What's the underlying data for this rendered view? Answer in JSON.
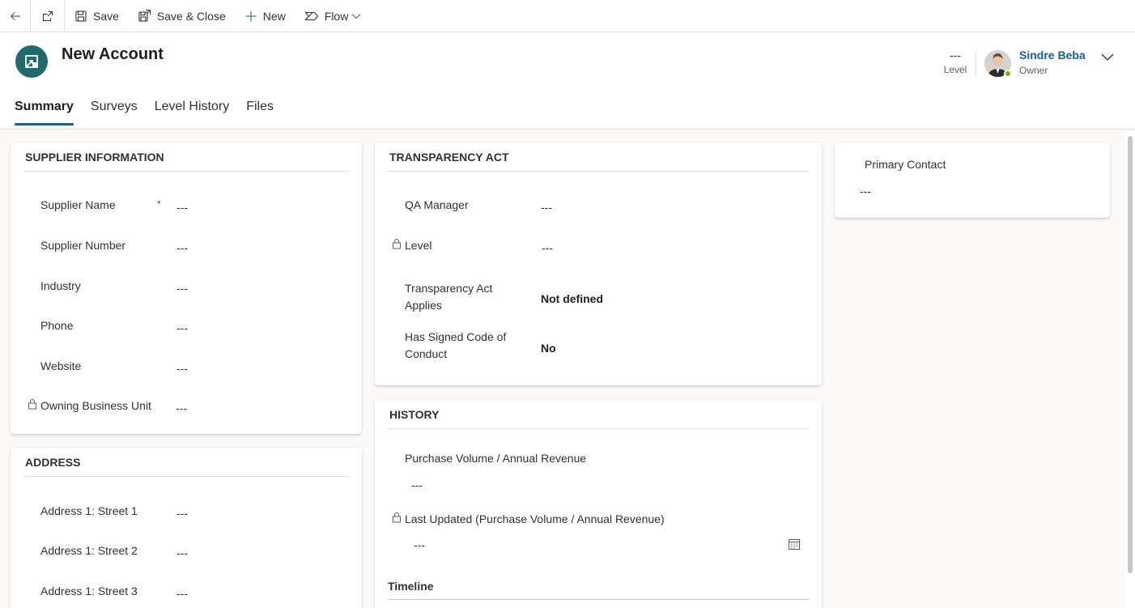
{
  "toolbar": {
    "save_label": "Save",
    "save_close_label": "Save & Close",
    "new_label": "New",
    "flow_label": "Flow"
  },
  "header": {
    "title": "New Account",
    "level_value": "---",
    "level_label": "Level",
    "owner_name": "Sindre Beba",
    "owner_label": "Owner"
  },
  "tabs": [
    {
      "label": "Summary",
      "active": true
    },
    {
      "label": "Surveys",
      "active": false
    },
    {
      "label": "Level History",
      "active": false
    },
    {
      "label": "Files",
      "active": false
    }
  ],
  "supplier_info": {
    "title": "SUPPLIER INFORMATION",
    "fields": [
      {
        "label": "Supplier Name",
        "value": "---"
      },
      {
        "label": "Supplier Number",
        "value": "---"
      },
      {
        "label": "Industry",
        "value": "---"
      },
      {
        "label": "Phone",
        "value": "---"
      },
      {
        "label": "Website",
        "value": "---"
      },
      {
        "label": "Owning Business Unit",
        "value": "---"
      }
    ],
    "required_marker": "*"
  },
  "address": {
    "title": "ADDRESS",
    "fields": [
      {
        "label": "Address 1: Street 1",
        "value": "---"
      },
      {
        "label": "Address 1: Street 2",
        "value": "---"
      },
      {
        "label": "Address 1: Street 3",
        "value": "---"
      }
    ]
  },
  "transparency": {
    "title": "TRANSPARENCY ACT",
    "fields": [
      {
        "label": "QA Manager",
        "value": "---"
      },
      {
        "label": "Level",
        "value": "---"
      },
      {
        "label_line1": "Transparency Act",
        "label_line2": "Applies",
        "value": "Not defined"
      },
      {
        "label_line1": "Has Signed Code of",
        "label_line2": "Conduct",
        "value": "No"
      }
    ]
  },
  "history": {
    "title": "HISTORY",
    "purchase_label": "Purchase Volume / Annual Revenue",
    "purchase_value": "---",
    "last_updated_label": "Last Updated (Purchase Volume / Annual Revenue)",
    "last_updated_value": "---",
    "timeline_label": "Timeline"
  },
  "primary_contact": {
    "label": "Primary Contact",
    "value": "---"
  },
  "colors": {
    "accent": "#115ea3",
    "entity_icon": "#1f6b6b",
    "presence": "#6bb700",
    "required": "#a4262c"
  }
}
